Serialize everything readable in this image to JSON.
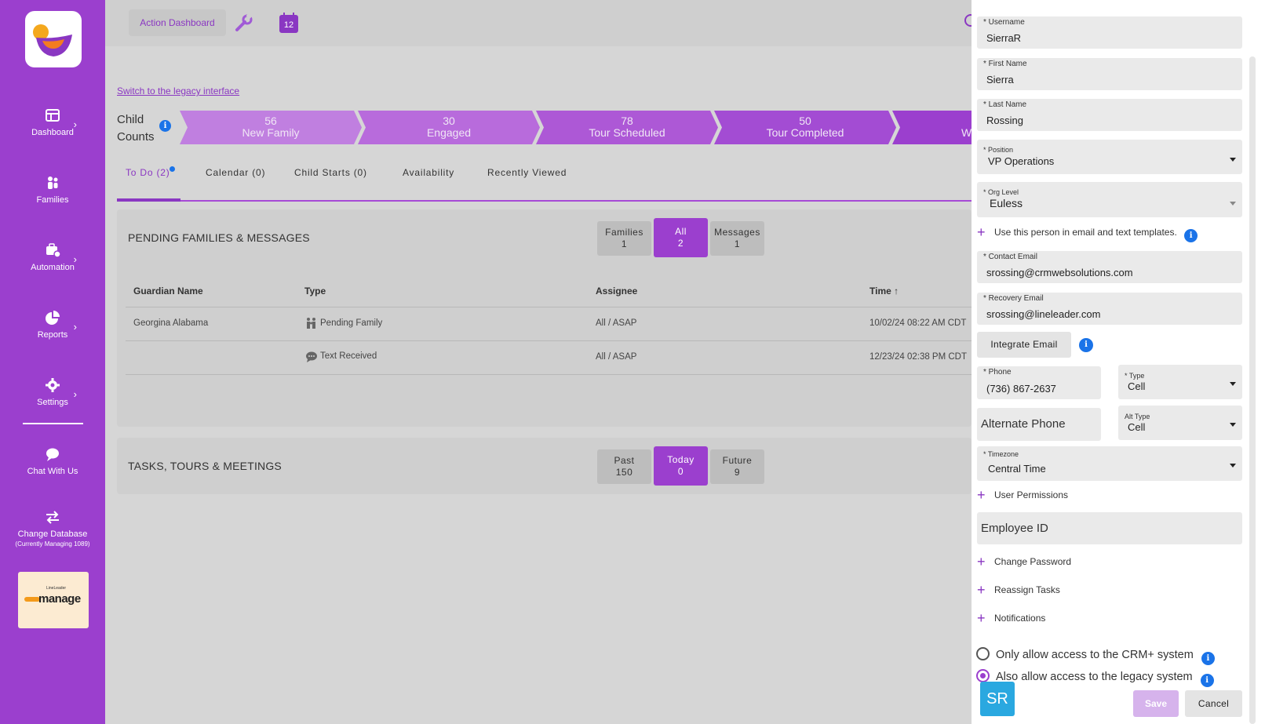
{
  "sidebar": {
    "items": [
      {
        "label": "Dashboard",
        "icon": "dashboard-icon"
      },
      {
        "label": "Families",
        "icon": "families-icon"
      },
      {
        "label": "Automation",
        "icon": "automation-icon"
      },
      {
        "label": "Reports",
        "icon": "reports-icon"
      },
      {
        "label": "Settings",
        "icon": "settings-icon"
      },
      {
        "label": "Chat With Us",
        "icon": "chat-icon"
      },
      {
        "label": "Change Database",
        "sub": "(Currently Managing 1089)",
        "icon": "swap-icon"
      }
    ],
    "manage_logo": {
      "small": "LineLeader",
      "text": "manage"
    }
  },
  "topbar": {
    "action_dashboard": "Action Dashboard",
    "calendar_day": "12"
  },
  "main": {
    "legacy_link": "Switch to the legacy interface",
    "child_counts_line1": "Child",
    "child_counts_line2": "Counts",
    "funnel": [
      {
        "count": "56",
        "label": "New Family"
      },
      {
        "count": "30",
        "label": "Engaged"
      },
      {
        "count": "78",
        "label": "Tour Scheduled"
      },
      {
        "count": "50",
        "label": "Tour Completed"
      },
      {
        "count": "",
        "label": "W"
      }
    ],
    "tabs": [
      "To Do (2)",
      "Calendar (0)",
      "Child Starts (0)",
      "Availability",
      "Recently Viewed"
    ],
    "pending": {
      "title": "PENDING FAMILIES & MESSAGES",
      "segments": [
        {
          "label": "Families",
          "count": "1"
        },
        {
          "label": "All",
          "count": "2"
        },
        {
          "label": "Messages",
          "count": "1"
        }
      ],
      "columns": [
        "Guardian Name",
        "Type",
        "Assignee",
        "Time"
      ],
      "rows": [
        {
          "guardian": "Georgina Alabama",
          "type": "Pending Family",
          "assignee": "All / ASAP",
          "time": "10/02/24 08:22 AM CDT"
        },
        {
          "guardian": "",
          "type": "Text Received",
          "assignee": "All / ASAP",
          "time": "12/23/24 02:38 PM CDT"
        }
      ]
    },
    "tasks": {
      "title": "TASKS, TOURS & MEETINGS",
      "segments": [
        {
          "label": "Past",
          "count": "150"
        },
        {
          "label": "Today",
          "count": "0"
        },
        {
          "label": "Future",
          "count": "9"
        }
      ]
    }
  },
  "panel": {
    "username": {
      "label": "* Username",
      "value": "SierraR"
    },
    "first_name": {
      "label": "* First Name",
      "value": "Sierra"
    },
    "last_name": {
      "label": "* Last Name",
      "value": "Rossing"
    },
    "position": {
      "label": "* Position",
      "value": "VP Operations"
    },
    "org_level": {
      "label": "* Org Level",
      "value": "Euless"
    },
    "use_in_templates": "Use this person in email and text templates.",
    "contact_email": {
      "label": "* Contact Email",
      "value": "srossing@crmwebsolutions.com"
    },
    "recovery_email": {
      "label": "* Recovery Email",
      "value": "srossing@lineleader.com"
    },
    "integrate_email": "Integrate Email",
    "phone": {
      "label": "* Phone",
      "value": "(736) 867-2637"
    },
    "phone_type": {
      "label": "* Type",
      "value": "Cell"
    },
    "alt_phone_placeholder": "Alternate Phone",
    "alt_type": {
      "label": "Alt Type",
      "value": "Cell"
    },
    "timezone": {
      "label": "* Timezone",
      "value": "Central Time"
    },
    "user_permissions": "User Permissions",
    "employee_id_placeholder": "Employee ID",
    "change_password": "Change Password",
    "reassign_tasks": "Reassign Tasks",
    "notifications": "Notifications",
    "radio_crm_only": "Only allow access to the CRM+ system",
    "radio_legacy": "Also allow access to the legacy system",
    "avatar_initials": "SR",
    "save": "Save",
    "cancel": "Cancel"
  },
  "colors": {
    "brand_purple": "#9b3fce",
    "info_blue": "#1a73e8",
    "funnel_purple": "#c07fe0"
  }
}
